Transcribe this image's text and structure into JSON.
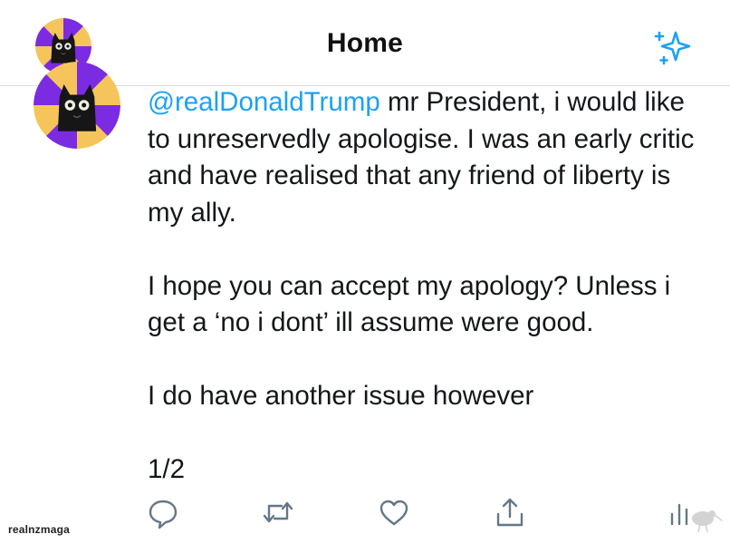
{
  "header": {
    "title": "Home",
    "avatar_icon": "cat-avatar-icon",
    "action_icon": "sparkle-icon",
    "accent_color": "#1da1f2"
  },
  "tweet": {
    "mention": "@realDonaldTrump",
    "text": " mr President, i would like to unreservedly apologise. I was an early critic and have realised that any friend of liberty is my ally.\n\nI hope you can accept my apology? Unless i get a ‘no i dont’ ill assume were good.\n\nI do have another issue however\n\n1/2",
    "avatar_icon": "cat-avatar-icon"
  },
  "actions": [
    {
      "name": "reply",
      "icon": "reply-icon"
    },
    {
      "name": "retweet",
      "icon": "retweet-icon"
    },
    {
      "name": "like",
      "icon": "heart-icon"
    },
    {
      "name": "share",
      "icon": "share-icon"
    },
    {
      "name": "stats",
      "icon": "stats-icon"
    }
  ],
  "watermark": {
    "text": "realnzmaga",
    "logo_icon": "kiwi-logo-icon"
  },
  "colors": {
    "text": "#14171a",
    "icon": "#657786",
    "divider": "#d7dbdf",
    "avatar_yellow": "#f5c55c",
    "avatar_purple": "#7b2be2"
  }
}
